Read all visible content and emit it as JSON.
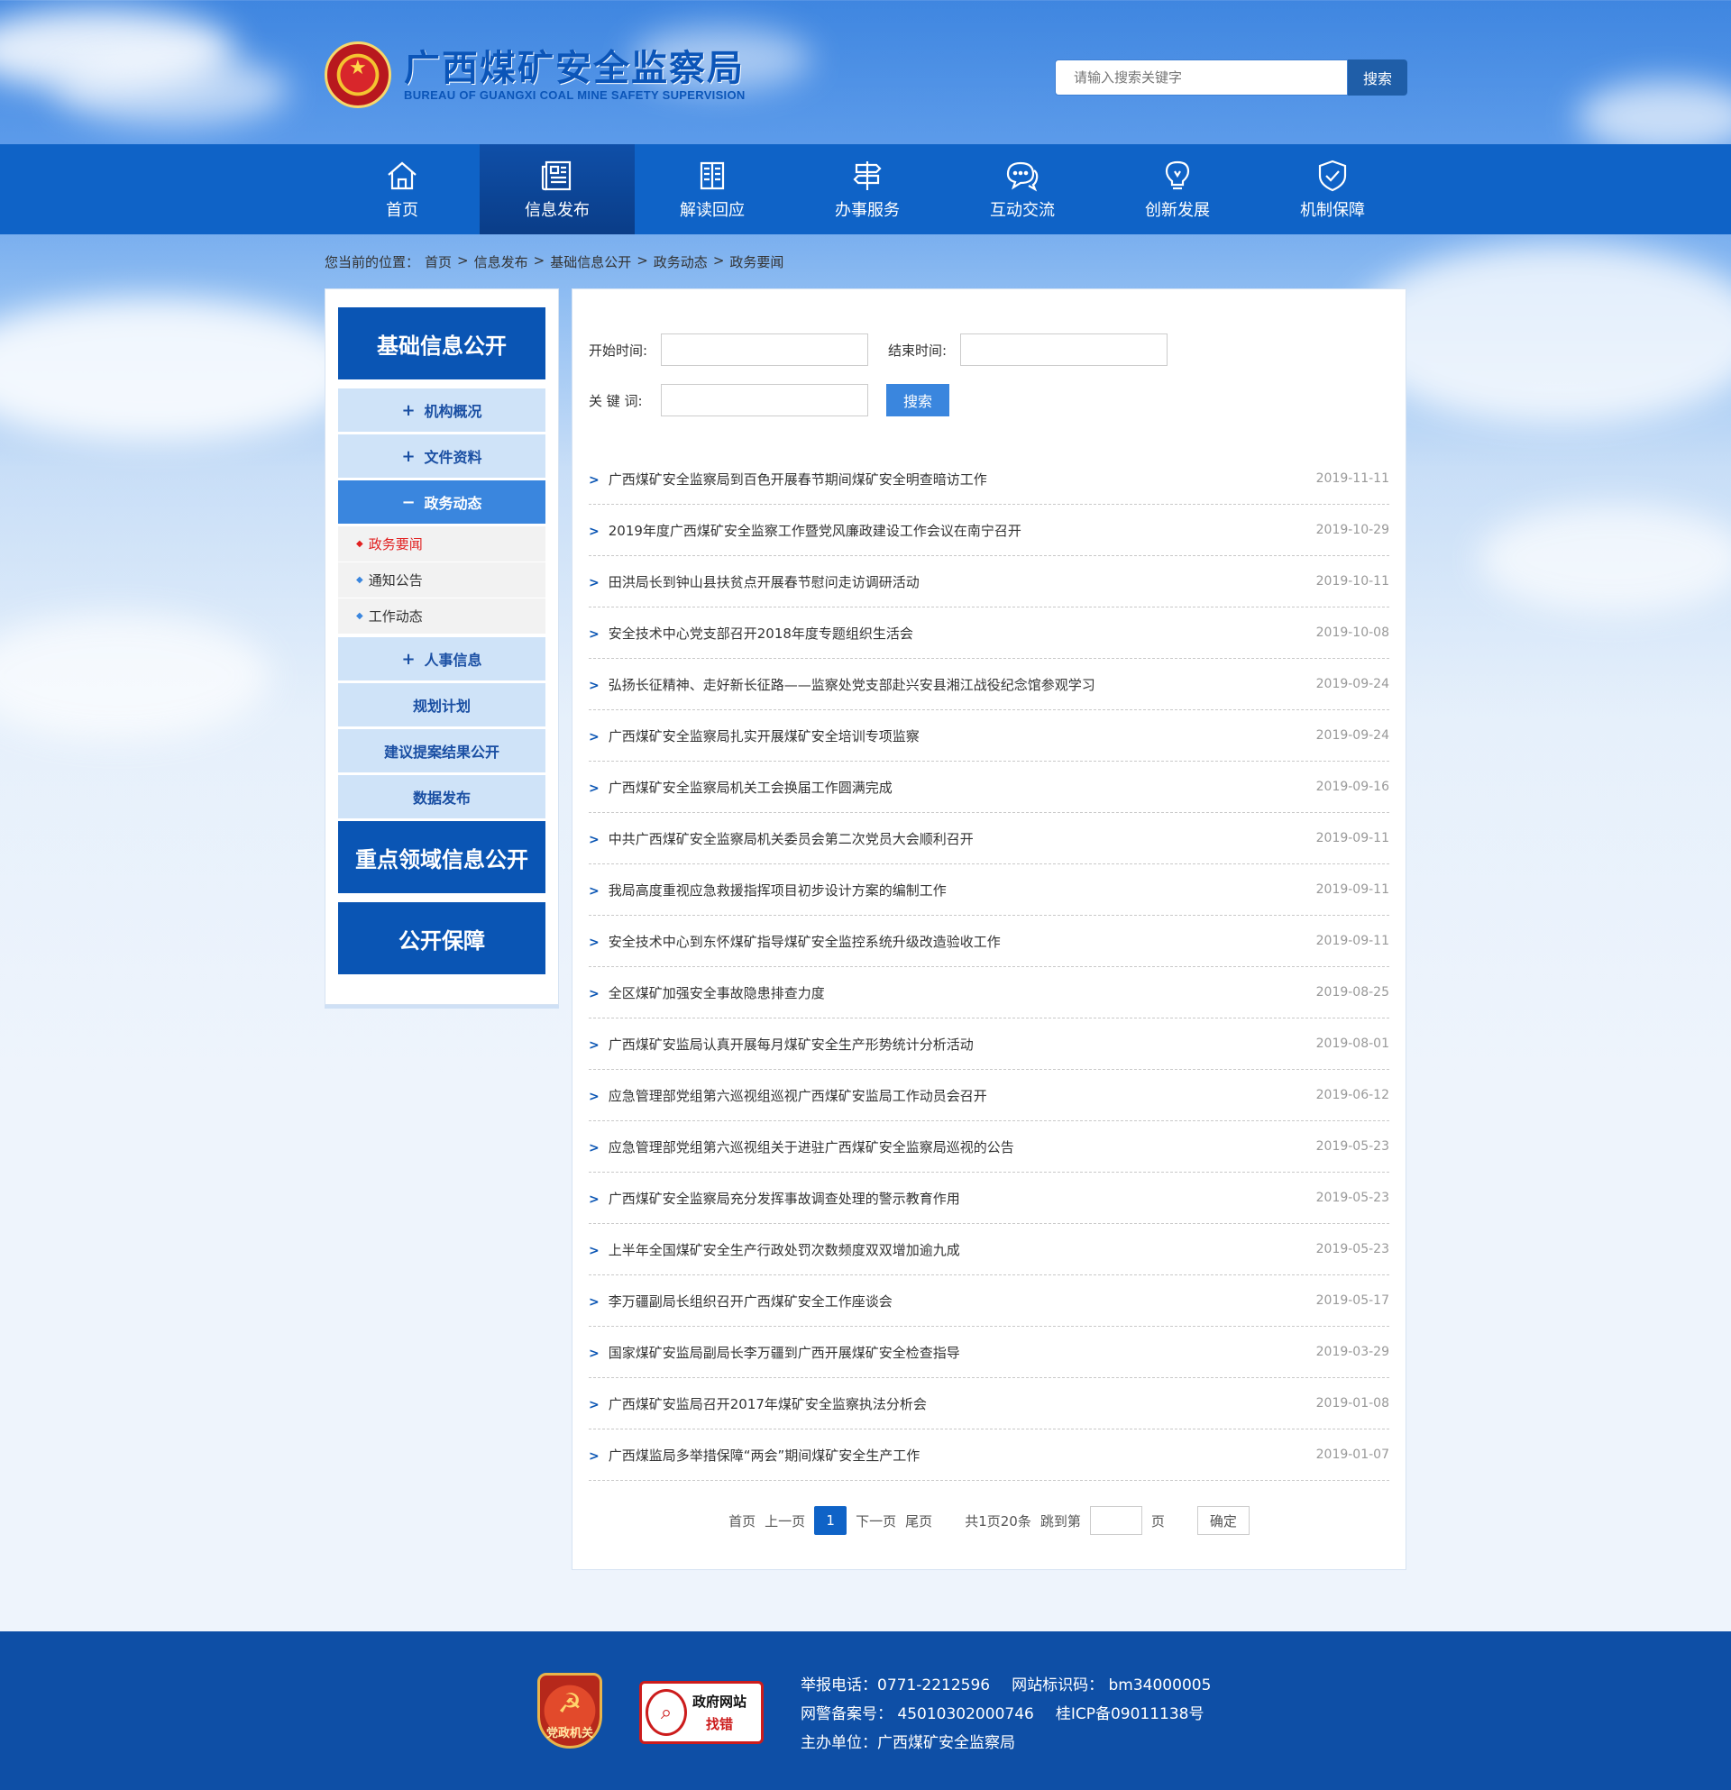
{
  "header": {
    "title_cn": "广西煤矿安全监察局",
    "title_en": "BUREAU OF GUANGXI COAL MINE SAFETY SUPERVISION",
    "search_placeholder": "请输入搜索关键字",
    "search_button": "搜索"
  },
  "nav": {
    "items": [
      {
        "label": "首页",
        "icon": "home-icon"
      },
      {
        "label": "信息发布",
        "icon": "newspaper-icon",
        "active": true
      },
      {
        "label": "解读回应",
        "icon": "book-icon"
      },
      {
        "label": "办事服务",
        "icon": "signpost-icon"
      },
      {
        "label": "互动交流",
        "icon": "chat-icon"
      },
      {
        "label": "创新发展",
        "icon": "lightbulb-icon"
      },
      {
        "label": "机制保障",
        "icon": "shield-icon"
      }
    ]
  },
  "breadcrumb": {
    "prefix": "您当前的位置：",
    "items": [
      "首页",
      "信息发布",
      "基础信息公开",
      "政务动态",
      "政务要闻"
    ],
    "separator": ">"
  },
  "sidebar": {
    "heading1": "基础信息公开",
    "items": [
      {
        "label": "机构概况",
        "mark": "+"
      },
      {
        "label": "文件资料",
        "mark": "+"
      },
      {
        "label": "政务动态",
        "mark": "−"
      }
    ],
    "sub_items": [
      "政务要闻",
      "通知公告",
      "工作动态"
    ],
    "items2": [
      {
        "label": "人事信息",
        "mark": "+"
      },
      {
        "label": "规划计划",
        "mark": ""
      },
      {
        "label": "建议提案结果公开",
        "mark": ""
      },
      {
        "label": "数据发布",
        "mark": ""
      }
    ],
    "heading2": "重点领域信息公开",
    "heading3": "公开保障"
  },
  "filter": {
    "start_label": "开始时间:",
    "end_label": "结束时间:",
    "keyword_label": "关 键 词:",
    "search_button": "搜索"
  },
  "news": [
    {
      "title": "广西煤矿安全监察局到百色开展春节期间煤矿安全明查暗访工作",
      "date": "2019-11-11"
    },
    {
      "title": "2019年度广西煤矿安全监察工作暨党风廉政建设工作会议在南宁召开",
      "date": "2019-10-29"
    },
    {
      "title": "田洪局长到钟山县扶贫点开展春节慰问走访调研活动",
      "date": "2019-10-11"
    },
    {
      "title": "安全技术中心党支部召开2018年度专题组织生活会",
      "date": "2019-10-08"
    },
    {
      "title": "弘扬长征精神、走好新长征路——监察处党支部赴兴安县湘江战役纪念馆参观学习",
      "date": "2019-09-24"
    },
    {
      "title": "广西煤矿安全监察局扎实开展煤矿安全培训专项监察",
      "date": "2019-09-24"
    },
    {
      "title": "广西煤矿安全监察局机关工会换届工作圆满完成",
      "date": "2019-09-16"
    },
    {
      "title": "中共广西煤矿安全监察局机关委员会第二次党员大会顺利召开",
      "date": "2019-09-11"
    },
    {
      "title": "我局高度重视应急救援指挥项目初步设计方案的编制工作",
      "date": "2019-09-11"
    },
    {
      "title": "安全技术中心到东怀煤矿指导煤矿安全监控系统升级改造验收工作",
      "date": "2019-09-11"
    },
    {
      "title": "全区煤矿加强安全事故隐患排查力度",
      "date": "2019-08-25"
    },
    {
      "title": "广西煤矿安监局认真开展每月煤矿安全生产形势统计分析活动",
      "date": "2019-08-01"
    },
    {
      "title": "应急管理部党组第六巡视组巡视广西煤矿安监局工作动员会召开",
      "date": "2019-06-12"
    },
    {
      "title": "应急管理部党组第六巡视组关于进驻广西煤矿安全监察局巡视的公告",
      "date": "2019-05-23"
    },
    {
      "title": "广西煤矿安全监察局充分发挥事故调查处理的警示教育作用",
      "date": "2019-05-23"
    },
    {
      "title": "上半年全国煤矿安全生产行政处罚次数频度双双增加逾九成",
      "date": "2019-05-23"
    },
    {
      "title": "李万疆副局长组织召开广西煤矿安全工作座谈会",
      "date": "2019-05-17"
    },
    {
      "title": "国家煤矿安监局副局长李万疆到广西开展煤矿安全检查指导",
      "date": "2019-03-29"
    },
    {
      "title": "广西煤矿安监局召开2017年煤矿安全监察执法分析会",
      "date": "2019-01-08"
    },
    {
      "title": "广西煤监局多举措保障“两会”期间煤矿安全生产工作",
      "date": "2019-01-07"
    }
  ],
  "pager": {
    "first": "首页",
    "prev": "上一页",
    "current": "1",
    "next": "下一页",
    "last": "尾页",
    "summary": "共1页20条",
    "jump_label": "跳到第",
    "page_unit": "页",
    "confirm": "确定"
  },
  "footer": {
    "badge1_text": "党政机关",
    "badge2_line1": "政府网站",
    "badge2_line2": "找错",
    "report_phone": "举报电话：0771-2212596",
    "site_code": "网站标识码： bm34000005",
    "police_record": "网警备案号：  45010302000746",
    "icp": "桂ICP备09011138号",
    "sponsor": "主办单位：广西煤矿安全监察局"
  }
}
